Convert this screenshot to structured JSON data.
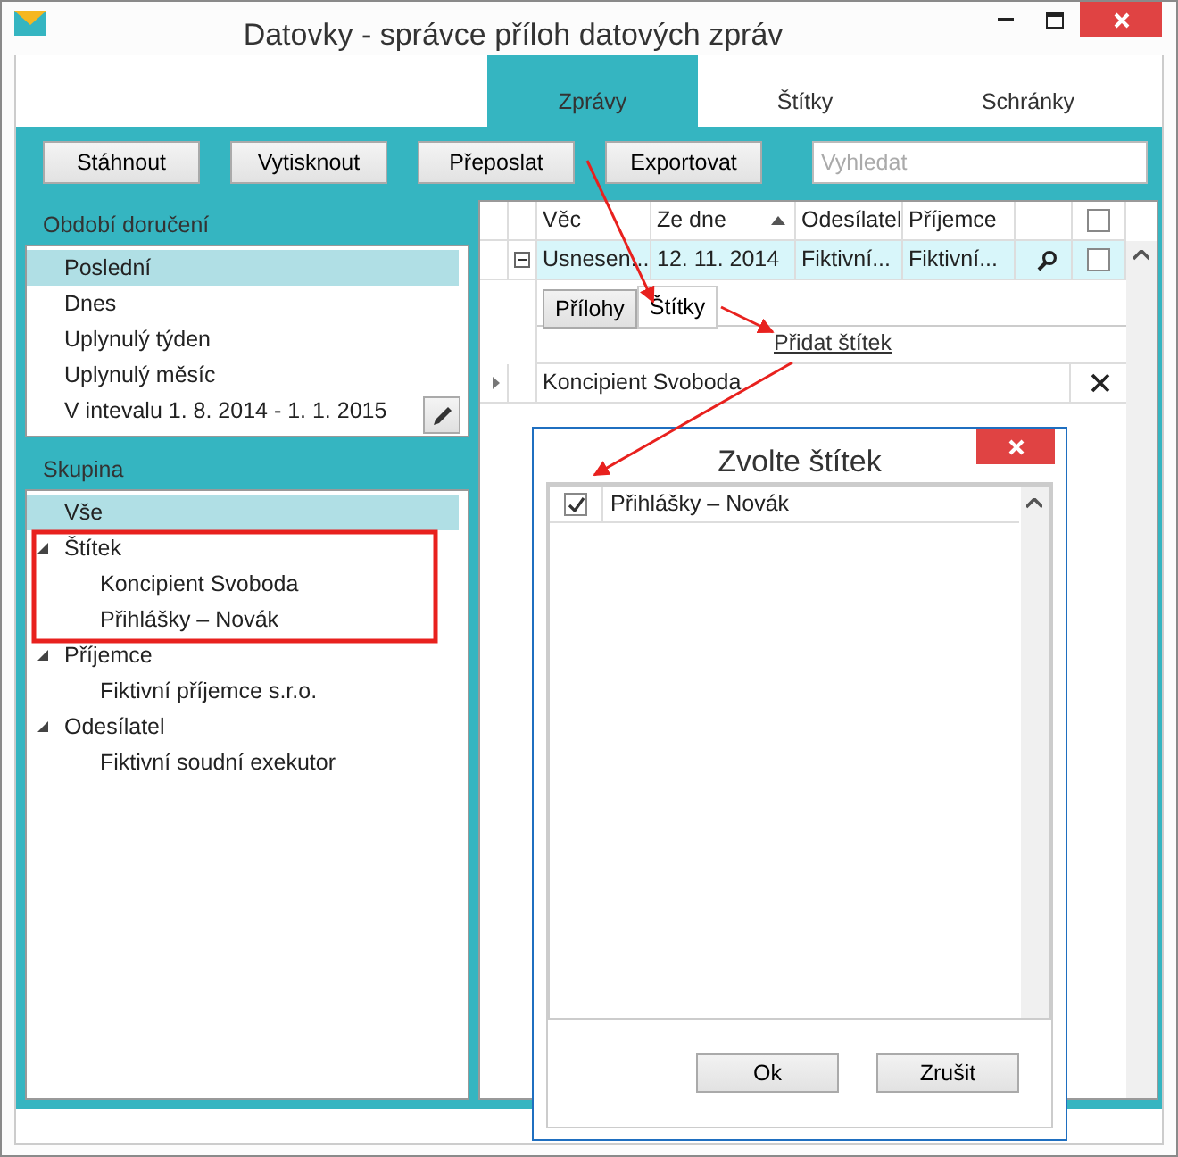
{
  "window": {
    "title": "Datovky - správce příloh datových zpráv"
  },
  "tabs": [
    {
      "label": "Zprávy",
      "selected": true
    },
    {
      "label": "Štítky",
      "selected": false
    },
    {
      "label": "Schránky",
      "selected": false
    }
  ],
  "toolbar": {
    "buttons": [
      "Stáhnout",
      "Vytisknout",
      "Přeposlat",
      "Exportovat"
    ],
    "search": {
      "placeholder": "Vyhledat"
    }
  },
  "period_panel": {
    "title": "Období doručení",
    "items": [
      {
        "label": "Poslední",
        "selected": true
      },
      {
        "label": "Dnes",
        "selected": false
      },
      {
        "label": "Uplynulý týden",
        "selected": false
      },
      {
        "label": "Uplynulý měsíc",
        "selected": false
      },
      {
        "label": "V intevalu 1. 8. 2014 - 1. 1. 2015",
        "selected": false
      }
    ]
  },
  "group_panel": {
    "title": "Skupina",
    "items": [
      {
        "label": "Vše",
        "selected": true
      },
      {
        "label": "Štítek",
        "selected": false,
        "expanded": true,
        "children": [
          {
            "label": "Koncipient Svoboda",
            "selected": false
          },
          {
            "label": "Přihlášky – Novák",
            "selected": false
          }
        ]
      },
      {
        "label": "Příjemce",
        "selected": false,
        "expanded": true,
        "children": [
          {
            "label": "Fiktivní příjemce s.r.o.",
            "selected": false
          }
        ]
      },
      {
        "label": "Odesílatel",
        "selected": false,
        "expanded": true,
        "children": [
          {
            "label": "Fiktivní soudní exekutor",
            "selected": false
          }
        ]
      }
    ]
  },
  "messages": {
    "header_checked": false,
    "columns": [
      {
        "label": "Věc",
        "sorted": false
      },
      {
        "label": "Ze dne",
        "sorted": true
      },
      {
        "label": "Odesílatel",
        "sorted": false
      },
      {
        "label": "Příjemce",
        "sorted": false
      }
    ],
    "rows": [
      {
        "cells": [
          "Usnesen...",
          "12. 11. 2014",
          "Fiktivní...",
          "Fiktivní..."
        ],
        "selected": true,
        "expanded": true,
        "checked": false
      }
    ],
    "detail": {
      "tabs": [
        {
          "label": "Přílohy",
          "selected": false
        },
        {
          "label": "Štítky",
          "selected": true
        }
      ],
      "add_link": "Přidat štítek",
      "tags": [
        "Koncipient Svoboda"
      ]
    }
  },
  "dialog": {
    "title": "Zvolte štítek",
    "items": [
      {
        "label": "Přihlášky – Novák",
        "checked": true
      }
    ],
    "buttons": [
      "Ok",
      "Zrušit"
    ]
  }
}
